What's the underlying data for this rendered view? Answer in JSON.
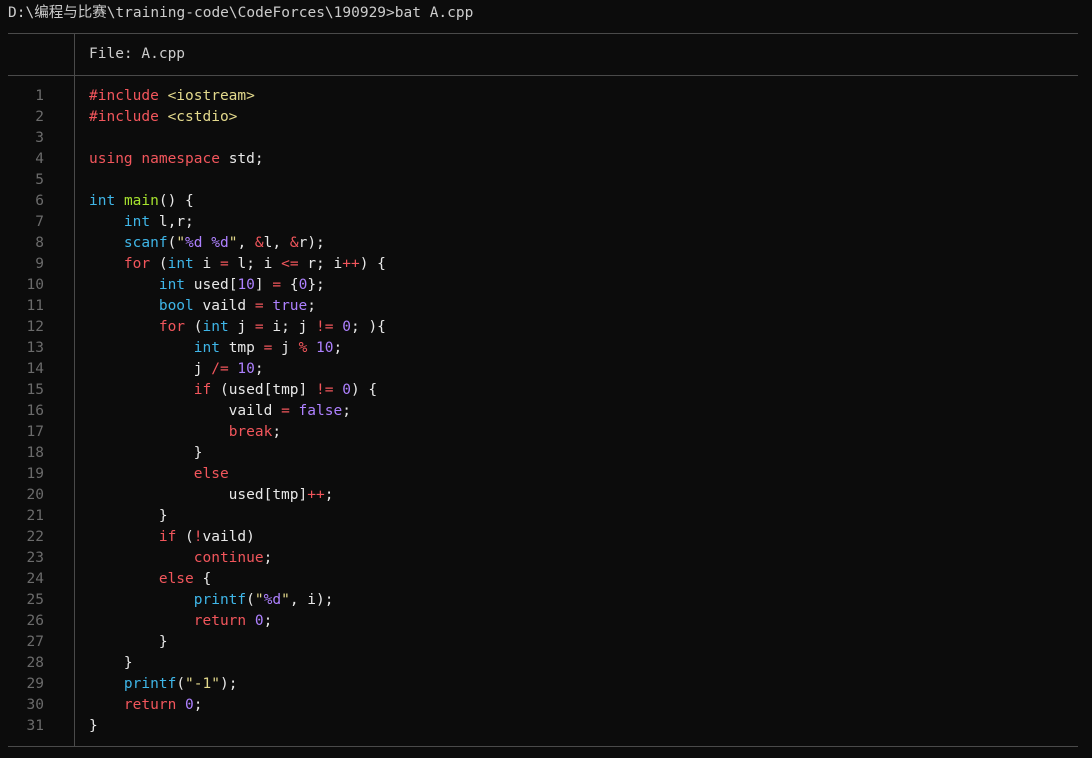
{
  "terminal": {
    "prompt": "D:\\编程与比赛\\training-code\\CodeForces\\190929>bat A.cpp"
  },
  "viewer": {
    "file_label": "File: A.cpp",
    "lines": [
      {
        "n": "1",
        "tokens": [
          [
            "pre",
            "#include"
          ],
          [
            "plain",
            " "
          ],
          [
            "inc",
            "<iostream>"
          ]
        ]
      },
      {
        "n": "2",
        "tokens": [
          [
            "pre",
            "#include"
          ],
          [
            "plain",
            " "
          ],
          [
            "inc",
            "<cstdio>"
          ]
        ]
      },
      {
        "n": "3",
        "tokens": []
      },
      {
        "n": "4",
        "tokens": [
          [
            "kw",
            "using"
          ],
          [
            "plain",
            " "
          ],
          [
            "kw",
            "namespace"
          ],
          [
            "plain",
            " std;"
          ]
        ]
      },
      {
        "n": "5",
        "tokens": []
      },
      {
        "n": "6",
        "tokens": [
          [
            "ty",
            "int"
          ],
          [
            "plain",
            " "
          ],
          [
            "fnd",
            "main"
          ],
          [
            "plain",
            "() {"
          ]
        ]
      },
      {
        "n": "7",
        "tokens": [
          [
            "plain",
            "    "
          ],
          [
            "ty",
            "int"
          ],
          [
            "plain",
            " l,r;"
          ]
        ]
      },
      {
        "n": "8",
        "tokens": [
          [
            "plain",
            "    "
          ],
          [
            "fn",
            "scanf"
          ],
          [
            "plain",
            "("
          ],
          [
            "str",
            "\""
          ],
          [
            "fmt",
            "%d"
          ],
          [
            "str",
            " "
          ],
          [
            "fmt",
            "%d"
          ],
          [
            "str",
            "\""
          ],
          [
            "plain",
            ", "
          ],
          [
            "op",
            "&"
          ],
          [
            "plain",
            "l, "
          ],
          [
            "op",
            "&"
          ],
          [
            "plain",
            "r);"
          ]
        ]
      },
      {
        "n": "9",
        "tokens": [
          [
            "plain",
            "    "
          ],
          [
            "kw",
            "for"
          ],
          [
            "plain",
            " ("
          ],
          [
            "ty",
            "int"
          ],
          [
            "plain",
            " i "
          ],
          [
            "op",
            "="
          ],
          [
            "plain",
            " l; i "
          ],
          [
            "op",
            "<="
          ],
          [
            "plain",
            " r; i"
          ],
          [
            "op",
            "++"
          ],
          [
            "plain",
            ") {"
          ]
        ]
      },
      {
        "n": "10",
        "tokens": [
          [
            "plain",
            "        "
          ],
          [
            "ty",
            "int"
          ],
          [
            "plain",
            " used["
          ],
          [
            "num",
            "10"
          ],
          [
            "plain",
            "] "
          ],
          [
            "op",
            "="
          ],
          [
            "plain",
            " {"
          ],
          [
            "num",
            "0"
          ],
          [
            "plain",
            "};"
          ]
        ]
      },
      {
        "n": "11",
        "tokens": [
          [
            "plain",
            "        "
          ],
          [
            "ty",
            "bool"
          ],
          [
            "plain",
            " vaild "
          ],
          [
            "op",
            "="
          ],
          [
            "plain",
            " "
          ],
          [
            "bool",
            "true"
          ],
          [
            "plain",
            ";"
          ]
        ]
      },
      {
        "n": "12",
        "tokens": [
          [
            "plain",
            "        "
          ],
          [
            "kw",
            "for"
          ],
          [
            "plain",
            " ("
          ],
          [
            "ty",
            "int"
          ],
          [
            "plain",
            " j "
          ],
          [
            "op",
            "="
          ],
          [
            "plain",
            " i; j "
          ],
          [
            "op",
            "!="
          ],
          [
            "plain",
            " "
          ],
          [
            "num",
            "0"
          ],
          [
            "plain",
            "; ){"
          ]
        ]
      },
      {
        "n": "13",
        "tokens": [
          [
            "plain",
            "            "
          ],
          [
            "ty",
            "int"
          ],
          [
            "plain",
            " tmp "
          ],
          [
            "op",
            "="
          ],
          [
            "plain",
            " j "
          ],
          [
            "op",
            "%"
          ],
          [
            "plain",
            " "
          ],
          [
            "num",
            "10"
          ],
          [
            "plain",
            ";"
          ]
        ]
      },
      {
        "n": "14",
        "tokens": [
          [
            "plain",
            "            j "
          ],
          [
            "op",
            "/="
          ],
          [
            "plain",
            " "
          ],
          [
            "num",
            "10"
          ],
          [
            "plain",
            ";"
          ]
        ]
      },
      {
        "n": "15",
        "tokens": [
          [
            "plain",
            "            "
          ],
          [
            "kw",
            "if"
          ],
          [
            "plain",
            " (used[tmp] "
          ],
          [
            "op",
            "!="
          ],
          [
            "plain",
            " "
          ],
          [
            "num",
            "0"
          ],
          [
            "plain",
            ") {"
          ]
        ]
      },
      {
        "n": "16",
        "tokens": [
          [
            "plain",
            "                vaild "
          ],
          [
            "op",
            "="
          ],
          [
            "plain",
            " "
          ],
          [
            "bool",
            "false"
          ],
          [
            "plain",
            ";"
          ]
        ]
      },
      {
        "n": "17",
        "tokens": [
          [
            "plain",
            "                "
          ],
          [
            "kw",
            "break"
          ],
          [
            "plain",
            ";"
          ]
        ]
      },
      {
        "n": "18",
        "tokens": [
          [
            "plain",
            "            }"
          ]
        ]
      },
      {
        "n": "19",
        "tokens": [
          [
            "plain",
            "            "
          ],
          [
            "kw",
            "else"
          ]
        ]
      },
      {
        "n": "20",
        "tokens": [
          [
            "plain",
            "                used[tmp]"
          ],
          [
            "op",
            "++"
          ],
          [
            "plain",
            ";"
          ]
        ]
      },
      {
        "n": "21",
        "tokens": [
          [
            "plain",
            "        }"
          ]
        ]
      },
      {
        "n": "22",
        "tokens": [
          [
            "plain",
            "        "
          ],
          [
            "kw",
            "if"
          ],
          [
            "plain",
            " ("
          ],
          [
            "op",
            "!"
          ],
          [
            "plain",
            "vaild)"
          ]
        ]
      },
      {
        "n": "23",
        "tokens": [
          [
            "plain",
            "            "
          ],
          [
            "kw",
            "continue"
          ],
          [
            "plain",
            ";"
          ]
        ]
      },
      {
        "n": "24",
        "tokens": [
          [
            "plain",
            "        "
          ],
          [
            "kw",
            "else"
          ],
          [
            "plain",
            " {"
          ]
        ]
      },
      {
        "n": "25",
        "tokens": [
          [
            "plain",
            "            "
          ],
          [
            "fn",
            "printf"
          ],
          [
            "plain",
            "("
          ],
          [
            "str",
            "\""
          ],
          [
            "fmt",
            "%d"
          ],
          [
            "str",
            "\""
          ],
          [
            "plain",
            ", i);"
          ]
        ]
      },
      {
        "n": "26",
        "tokens": [
          [
            "plain",
            "            "
          ],
          [
            "kw",
            "return"
          ],
          [
            "plain",
            " "
          ],
          [
            "num",
            "0"
          ],
          [
            "plain",
            ";"
          ]
        ]
      },
      {
        "n": "27",
        "tokens": [
          [
            "plain",
            "        }"
          ]
        ]
      },
      {
        "n": "28",
        "tokens": [
          [
            "plain",
            "    }"
          ]
        ]
      },
      {
        "n": "29",
        "tokens": [
          [
            "plain",
            "    "
          ],
          [
            "fn",
            "printf"
          ],
          [
            "plain",
            "("
          ],
          [
            "str",
            "\"-1\""
          ],
          [
            "plain",
            ");"
          ]
        ]
      },
      {
        "n": "30",
        "tokens": [
          [
            "plain",
            "    "
          ],
          [
            "kw",
            "return"
          ],
          [
            "plain",
            " "
          ],
          [
            "num",
            "0"
          ],
          [
            "plain",
            ";"
          ]
        ]
      },
      {
        "n": "31",
        "tokens": [
          [
            "plain",
            "}"
          ]
        ]
      }
    ]
  }
}
